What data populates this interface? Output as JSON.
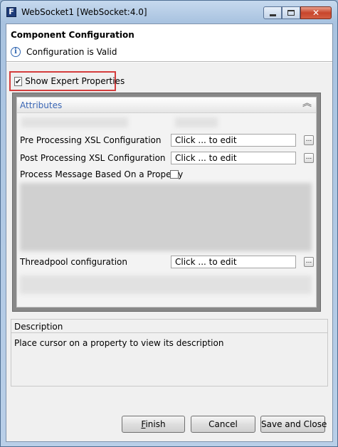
{
  "window": {
    "title": "WebSocket1 [WebSocket:4.0]",
    "app_icon_letter": "F"
  },
  "header": {
    "title": "Component Configuration",
    "status": "Configuration is Valid"
  },
  "expert": {
    "label": "Show Expert Properties",
    "checked": true
  },
  "attributes": {
    "title": "Attributes",
    "rows": [
      {
        "label": "Pre Processing XSL Configuration",
        "value": "Click ... to edit",
        "button": "..."
      },
      {
        "label": "Post Processing XSL Configuration",
        "value": "Click ... to edit",
        "button": "..."
      },
      {
        "label": "Process Message Based On a Property"
      },
      {
        "label": "Threadpool configuration",
        "value": "Click ... to edit",
        "button": "..."
      }
    ]
  },
  "description": {
    "title": "Description",
    "text": "Place cursor on a property to view its description"
  },
  "buttons": {
    "finish_first": "F",
    "finish_rest": "inish",
    "cancel": "Cancel",
    "save_close": "Save and Close"
  },
  "colors": {
    "highlight_border": "#d43d3d",
    "attributes_title": "#3a66b5",
    "close_button": "#c8452c"
  }
}
